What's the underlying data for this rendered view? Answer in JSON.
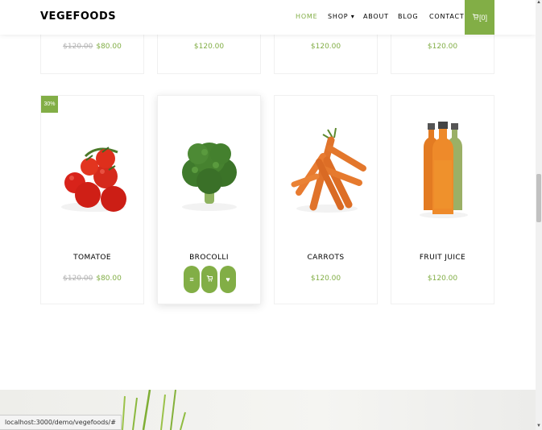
{
  "brand": "VEGEFOODS",
  "nav": {
    "home": "HOME",
    "shop": "SHOP ▾",
    "about": "ABOUT",
    "blog": "BLOG",
    "contact": "CONTACT",
    "cart": "[0]"
  },
  "top_row": [
    {
      "old_price": "$120.00",
      "price": "$80.00"
    },
    {
      "old_price": "",
      "price": "$120.00"
    },
    {
      "old_price": "",
      "price": "$120.00"
    },
    {
      "old_price": "",
      "price": "$120.00"
    }
  ],
  "products": [
    {
      "name": "TOMATOE",
      "old_price": "$120.00",
      "price": "$80.00",
      "badge": "30%"
    },
    {
      "name": "BROCOLLI",
      "old_price": "",
      "price": "$120.00"
    },
    {
      "name": "CARROTS",
      "old_price": "",
      "price": "$120.00"
    },
    {
      "name": "FRUIT JUICE",
      "old_price": "",
      "price": "$120.00"
    }
  ],
  "actions": {
    "menu": "≡",
    "cart": "🛒",
    "heart": "♥"
  },
  "status_url": "localhost:3000/demo/vegefoods/#",
  "colors": {
    "accent": "#82ae46"
  }
}
